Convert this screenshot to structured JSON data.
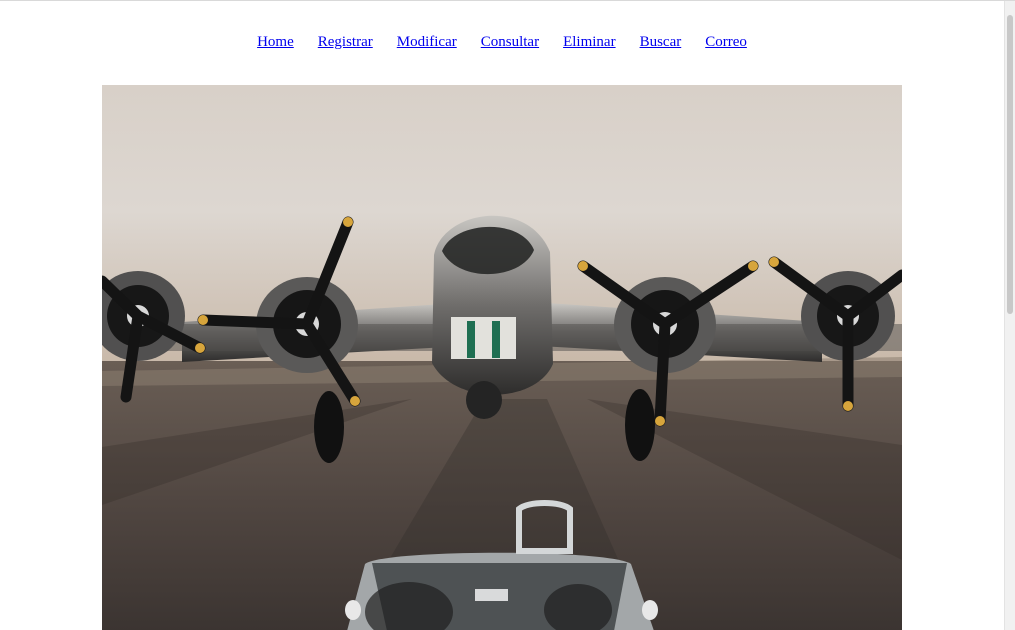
{
  "nav": {
    "items": [
      {
        "label": "Home"
      },
      {
        "label": "Registrar"
      },
      {
        "label": "Modificar"
      },
      {
        "label": "Consultar"
      },
      {
        "label": "Eliminar"
      },
      {
        "label": "Buscar"
      },
      {
        "label": "Correo"
      }
    ]
  },
  "hero": {
    "subject": "vintage four-engine airplane on runway with classic open-top car in foreground"
  },
  "scrollbar": {
    "position": 0.02
  }
}
